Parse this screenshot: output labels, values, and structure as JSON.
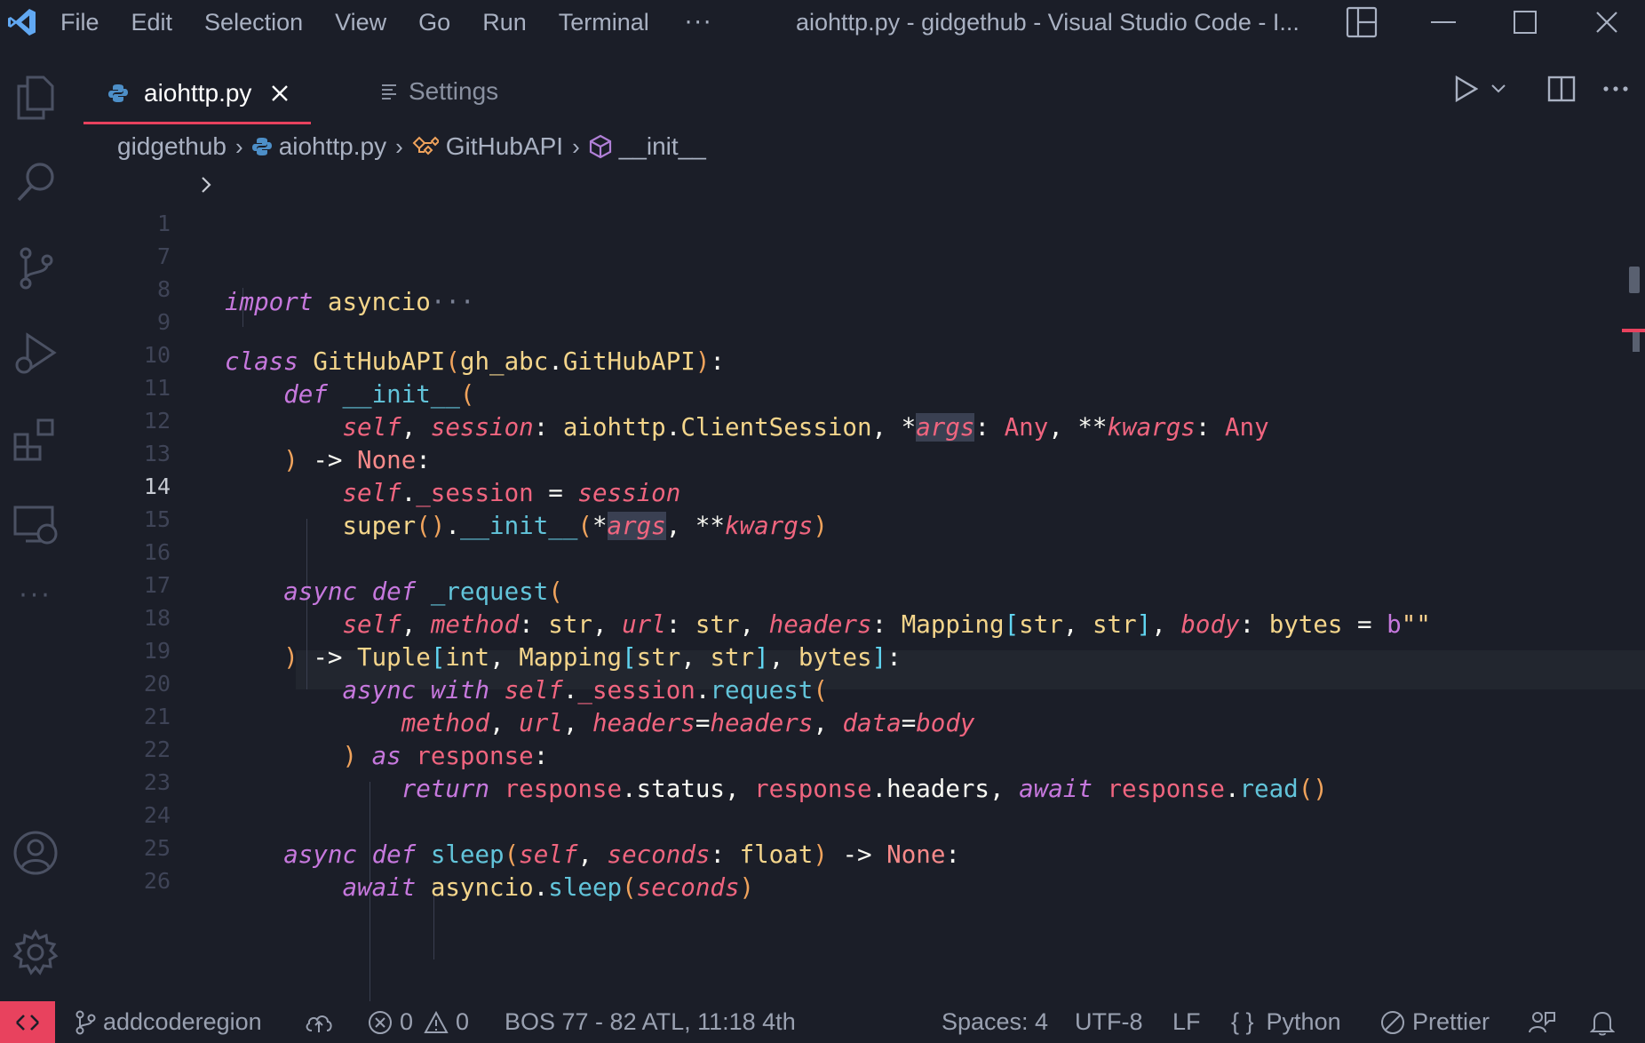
{
  "menu": {
    "items": [
      "File",
      "Edit",
      "Selection",
      "View",
      "Go",
      "Run",
      "Terminal"
    ],
    "more": "···"
  },
  "window": {
    "title": "aiohttp.py - gidgethub - Visual Studio Code - I..."
  },
  "activity_bar": {
    "icons": [
      "explorer-icon",
      "search-icon",
      "source-control-icon",
      "run-debug-icon",
      "extensions-icon",
      "remote-explorer-icon",
      "more-icon",
      "accounts-icon",
      "settings-gear-icon"
    ],
    "more_label": "···"
  },
  "tabs": [
    {
      "label": "aiohttp.py",
      "icon": "python-icon",
      "active": true
    },
    {
      "label": "Settings",
      "icon": "settings-list-icon",
      "active": false
    }
  ],
  "breadcrumb": {
    "items": [
      {
        "label": "gidgethub",
        "icon": null
      },
      {
        "label": "aiohttp.py",
        "icon": "python-icon"
      },
      {
        "label": "GitHubAPI",
        "icon": "class-icon"
      },
      {
        "label": "__init__",
        "icon": "method-cube-icon"
      }
    ]
  },
  "editor": {
    "current_line": "14",
    "line_numbers": [
      "1",
      "7",
      "8",
      "9",
      "10",
      "11",
      "12",
      "13",
      "14",
      "15",
      "16",
      "17",
      "18",
      "19",
      "20",
      "21",
      "22",
      "23",
      "24",
      "25",
      "26"
    ],
    "folded_line_text": {
      "keyword": "import",
      "name": "asyncio",
      "ellipsis": "···"
    }
  },
  "status_bar": {
    "branch": "addcoderegion",
    "errors": "0",
    "warnings": "0",
    "position": "BOS 77 - 82 ATL, 11:18 4th",
    "spaces": "Spaces: 4",
    "encoding": "UTF-8",
    "eol": "LF",
    "language": "Python",
    "formatter": "Prettier"
  },
  "colors": {
    "accent": "#e8425e",
    "background": "#1b1e28",
    "keyword": "#c678dd",
    "self": "#f0657f",
    "class": "#f4d58b",
    "builtin": "#61d6f2"
  }
}
